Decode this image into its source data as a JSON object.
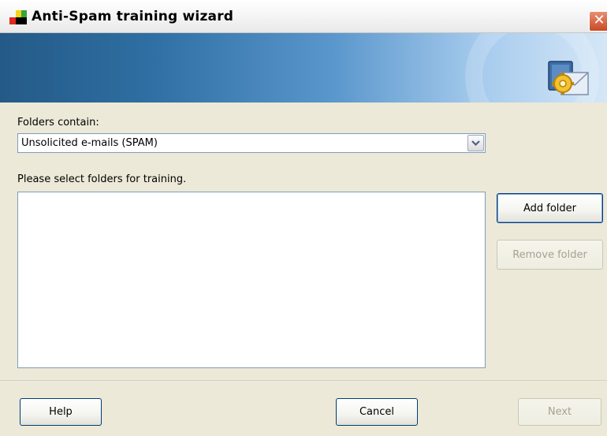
{
  "window": {
    "title": "Anti-Spam training wizard",
    "close_icon": "close-icon",
    "logo_icon": "app-logo-icon"
  },
  "banner": {
    "icon": "mail-gear-icon"
  },
  "form": {
    "folders_label": "Folders contain:",
    "folder_type": {
      "selected": "Unsolicited e-mails (SPAM)"
    },
    "select_label": "Please select folders for training."
  },
  "buttons": {
    "add_folder": "Add folder",
    "remove_folder": "Remove folder",
    "help": "Help",
    "cancel": "Cancel",
    "next": "Next"
  },
  "colors": {
    "banner_dark": "#245a87",
    "banner_light": "#d5e7f7",
    "close_button": "#c94a23"
  }
}
